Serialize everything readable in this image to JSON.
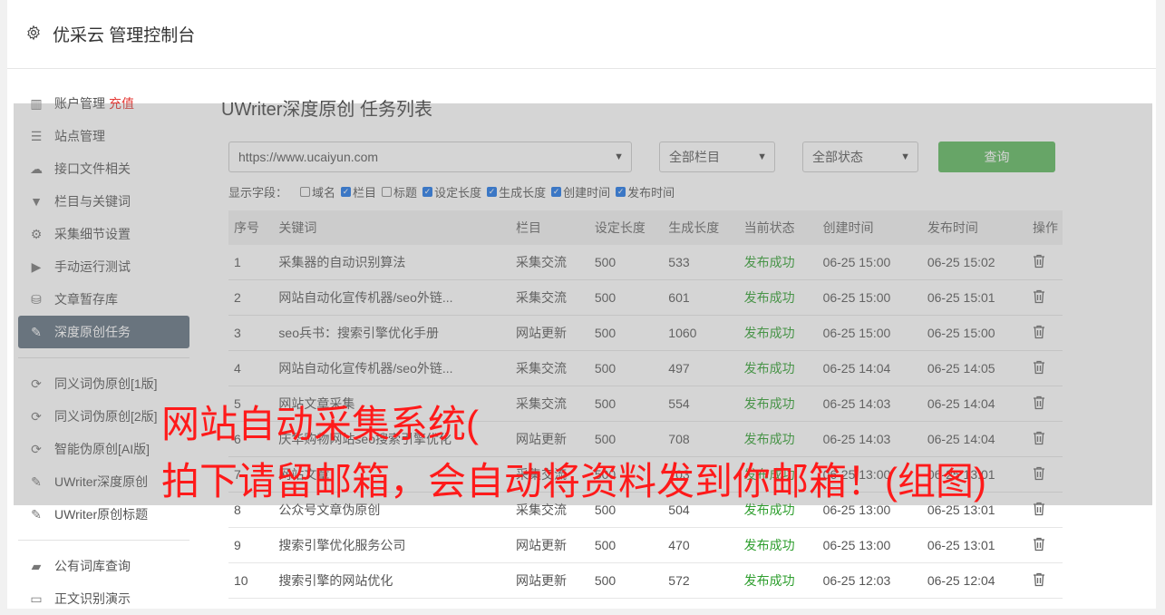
{
  "header": {
    "title": "优采云 管理控制台"
  },
  "sidebar": {
    "items": [
      {
        "label": "账户管理",
        "extra": "充值",
        "icon": "bar-chart-icon"
      },
      {
        "label": "站点管理",
        "icon": "server-icon"
      },
      {
        "label": "接口文件相关",
        "icon": "cloud-upload-icon"
      },
      {
        "label": "栏目与关键词",
        "icon": "filter-icon"
      },
      {
        "label": "采集细节设置",
        "icon": "cogs-icon"
      },
      {
        "label": "手动运行测试",
        "icon": "play-icon"
      },
      {
        "label": "文章暂存库",
        "icon": "database-icon"
      },
      {
        "label": "深度原创任务",
        "icon": "edit-icon",
        "active": true
      }
    ],
    "items2": [
      {
        "label": "同义词伪原创[1版]",
        "icon": "refresh-icon"
      },
      {
        "label": "同义词伪原创[2版]",
        "icon": "refresh-icon"
      },
      {
        "label": "智能伪原创[AI版]",
        "icon": "refresh-icon"
      },
      {
        "label": "UWriter深度原创",
        "icon": "edit-icon"
      },
      {
        "label": "UWriter原创标题",
        "icon": "edit-icon"
      }
    ],
    "items3": [
      {
        "label": "公有词库查询",
        "icon": "book-icon"
      },
      {
        "label": "正文识别演示",
        "icon": "desktop-icon"
      }
    ]
  },
  "main": {
    "title": "UWriter深度原创 任务列表",
    "site_select": "https://www.ucaiyun.com",
    "column_select": "全部栏目",
    "status_select": "全部状态",
    "query_button": "查询",
    "fields_label": "显示字段：",
    "fields": [
      {
        "label": "域名",
        "checked": false
      },
      {
        "label": "栏目",
        "checked": true
      },
      {
        "label": "标题",
        "checked": false
      },
      {
        "label": "设定长度",
        "checked": true
      },
      {
        "label": "生成长度",
        "checked": true
      },
      {
        "label": "创建时间",
        "checked": true
      },
      {
        "label": "发布时间",
        "checked": true
      }
    ],
    "columns": [
      "序号",
      "关键词",
      "栏目",
      "设定长度",
      "生成长度",
      "当前状态",
      "创建时间",
      "发布时间",
      "操作"
    ],
    "rows": [
      [
        "1",
        "采集器的自动识别算法",
        "采集交流",
        "500",
        "533",
        "发布成功",
        "06-25 15:00",
        "06-25 15:02"
      ],
      [
        "2",
        "网站自动化宣传机器/seo外链...",
        "采集交流",
        "500",
        "601",
        "发布成功",
        "06-25 15:00",
        "06-25 15:01"
      ],
      [
        "3",
        "seo兵书：搜索引擎优化手册",
        "网站更新",
        "500",
        "1060",
        "发布成功",
        "06-25 15:00",
        "06-25 15:00"
      ],
      [
        "4",
        "网站自动化宣传机器/seo外链...",
        "采集交流",
        "500",
        "497",
        "发布成功",
        "06-25 14:04",
        "06-25 14:05"
      ],
      [
        "5",
        "网站文章采集",
        "采集交流",
        "500",
        "554",
        "发布成功",
        "06-25 14:03",
        "06-25 14:04"
      ],
      [
        "6",
        "庆华购物网站seo搜索引擎优化",
        "网站更新",
        "500",
        "708",
        "发布成功",
        "06-25 14:03",
        "06-25 14:04"
      ],
      [
        "7",
        "网站文章",
        "采集交流",
        "500",
        "103",
        "发布成功",
        "06-25 13:00",
        "06-25 13:01"
      ],
      [
        "8",
        "公众号文章伪原创",
        "采集交流",
        "500",
        "504",
        "发布成功",
        "06-25 13:00",
        "06-25 13:01"
      ],
      [
        "9",
        "搜索引擎优化服务公司",
        "网站更新",
        "500",
        "470",
        "发布成功",
        "06-25 13:00",
        "06-25 13:01"
      ],
      [
        "10",
        "搜索引擎的网站优化",
        "网站更新",
        "500",
        "572",
        "发布成功",
        "06-25 12:03",
        "06-25 12:04"
      ]
    ]
  },
  "overlay": {
    "line1": "网站自动采集系统(",
    "line2": "拍下请留邮箱，会自动将资料发到你邮箱！(组图)"
  },
  "colors": {
    "accent_green": "#5cb85c",
    "status_green": "#2e9e2e",
    "active_nav": "#5f6f7e",
    "overlay_text": "#ff1a1a"
  }
}
